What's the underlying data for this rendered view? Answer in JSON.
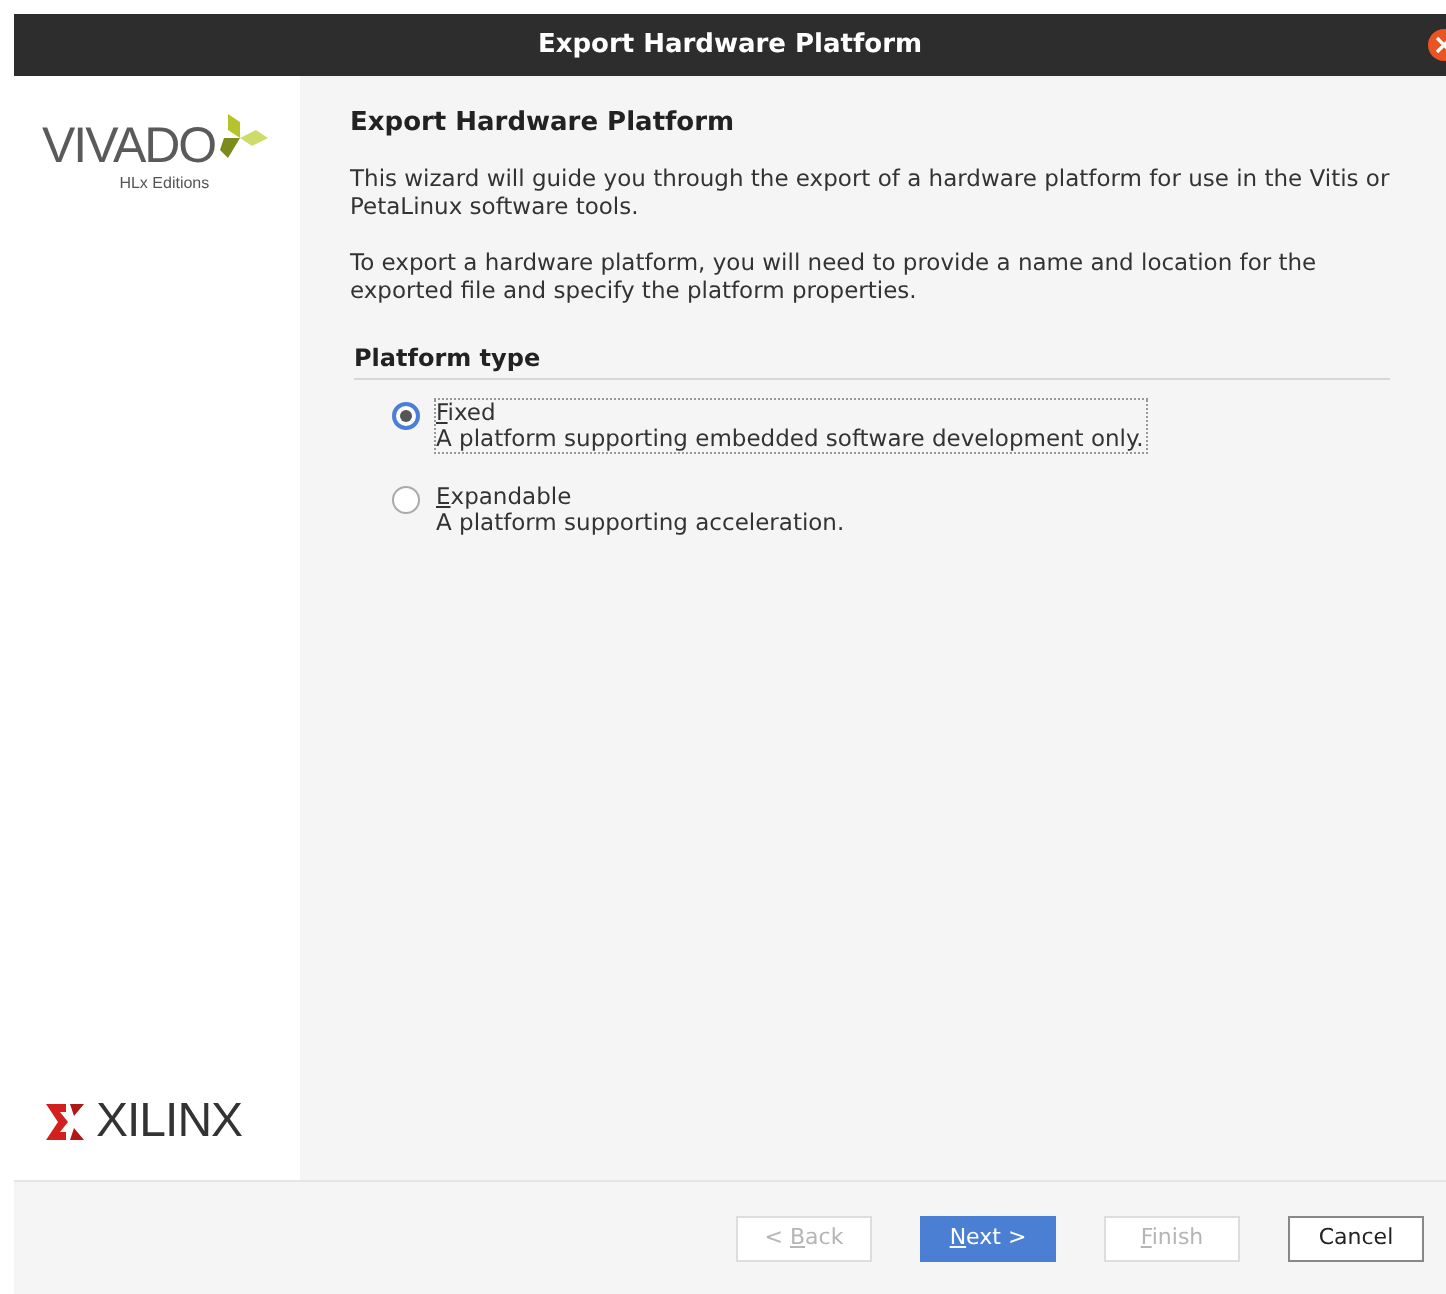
{
  "window": {
    "title": "Export Hardware Platform"
  },
  "sidebar": {
    "product_logo": {
      "name": "VIVADO",
      "subtitle": "HLx Editions"
    },
    "vendor_logo": {
      "name": "XILINX"
    }
  },
  "page": {
    "heading": "Export Hardware Platform",
    "paragraphs": [
      "This wizard will guide you through the export of a hardware platform for use in the Vitis or PetaLinux software tools.",
      "To export a hardware platform, you will need to provide a name and location for the exported file and specify the platform properties."
    ]
  },
  "platform_type": {
    "title": "Platform type",
    "options": [
      {
        "key": "F",
        "rest": "ixed",
        "description": "A platform supporting embedded software development only.",
        "selected": true,
        "focused": true
      },
      {
        "key": "E",
        "rest": "xpandable",
        "description": "A platform supporting acceleration.",
        "selected": false,
        "focused": false
      }
    ]
  },
  "buttons": [
    {
      "prefix": "< ",
      "key": "B",
      "rest": "ack",
      "disabled": true,
      "default": false
    },
    {
      "key": "N",
      "rest": "ext >",
      "disabled": false,
      "default": true
    },
    {
      "key": "F",
      "rest": "inish",
      "disabled": true,
      "default": false
    },
    {
      "rest": "Cancel",
      "disabled": false,
      "default": false
    }
  ]
}
